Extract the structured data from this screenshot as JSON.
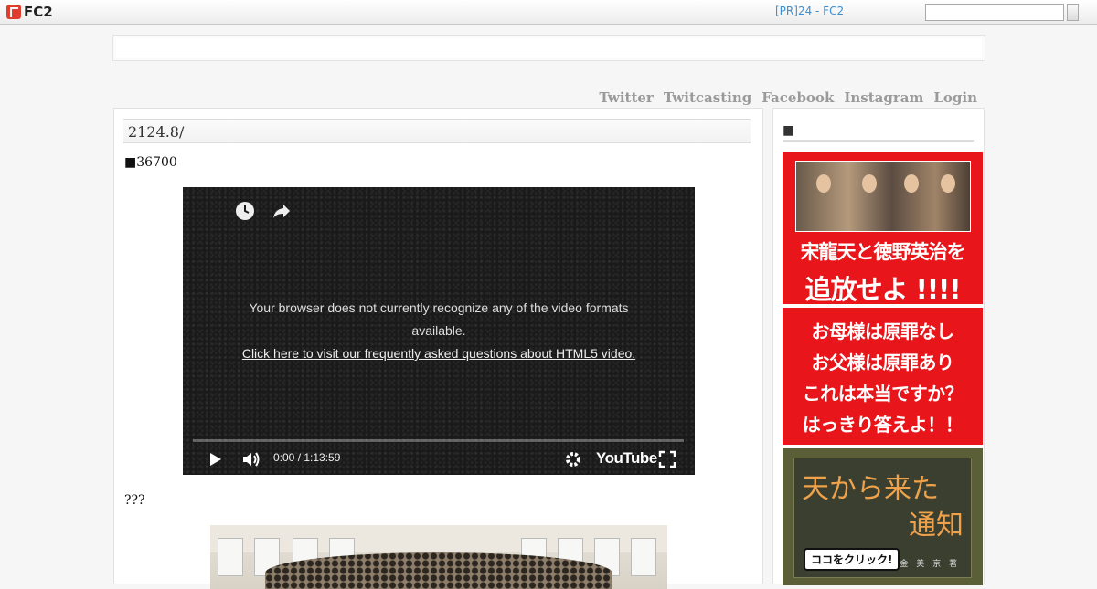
{
  "topbar": {
    "logo_text": "FC2",
    "pr_link": "[PR]24 - FC2",
    "search_placeholder": ""
  },
  "nav": [
    "Twitter",
    "Twitcasting",
    "Facebook",
    "Instagram",
    "Login"
  ],
  "entry": {
    "title": "2124.8/",
    "subtitle": "■36700",
    "caption": "???"
  },
  "video": {
    "message_line": "Your browser does not currently recognize any of the video formats available.",
    "faq_link": "Click here to visit our frequently asked questions about HTML5 video.",
    "time": "0:00 / 1:13:59",
    "brand": "YouTube"
  },
  "sidebar": {
    "title": "■",
    "banner1": {
      "line1": "宋龍天と徳野英治を",
      "line2": "追放せよ !!!!"
    },
    "banner2": {
      "lines": [
        "お母様は原罪なし",
        "お父様は原罪あり",
        "これは本当ですか？",
        "はっきり答えよ！！"
      ]
    },
    "banner3": {
      "title1": "天から来た",
      "title2": "通知",
      "button": "ココをクリック!",
      "author": "金 美 京 著"
    }
  },
  "colors": {
    "accent_red": "#e8161a",
    "link_blue": "#3f8fd0",
    "nav_gray": "#9a9a9a"
  }
}
